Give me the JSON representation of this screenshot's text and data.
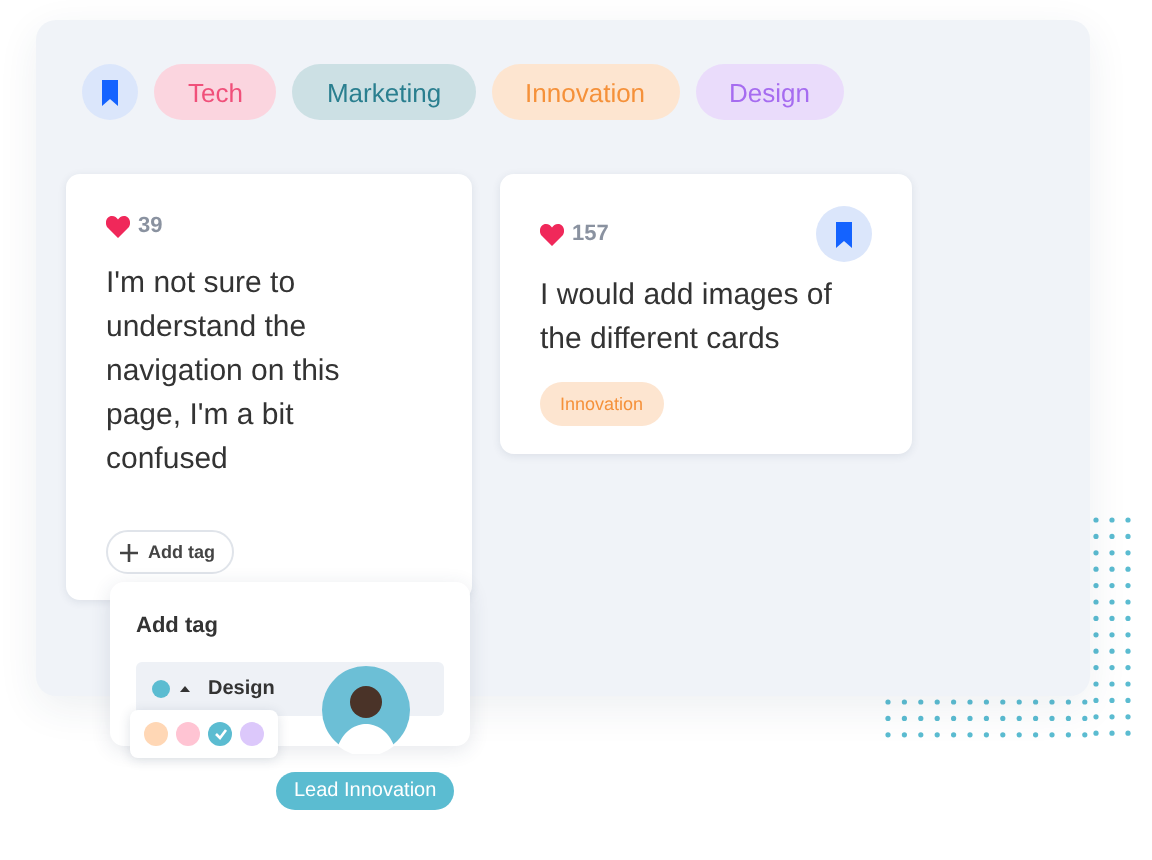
{
  "filters": {
    "tags": [
      {
        "label": "Tech",
        "color": "#f0507a"
      },
      {
        "label": "Marketing",
        "color": "#2a7f8f"
      },
      {
        "label": "Innovation",
        "color": "#f5913a"
      },
      {
        "label": "Design",
        "color": "#a66cf0"
      }
    ]
  },
  "cards": [
    {
      "likes": "39",
      "text": "I'm not sure to understand the navigation on this page, I'm a bit confused",
      "bookmarked": false,
      "add_tag": "Add tag"
    },
    {
      "likes": "157",
      "text": "I would add images of the different cards",
      "bookmarked": true,
      "tags": [
        {
          "label": "Innovation",
          "color": "#f5913a"
        }
      ]
    }
  ],
  "tag_popup": {
    "title": "Add tag",
    "value": "Design",
    "swatches": [
      {
        "color": "#ffd7b5",
        "selected": false
      },
      {
        "color": "#ffc4d3",
        "selected": false
      },
      {
        "color": "#5bbcd1",
        "selected": true
      },
      {
        "color": "#dcc8fb",
        "selected": false
      }
    ]
  },
  "badge": "Lead Innovation"
}
